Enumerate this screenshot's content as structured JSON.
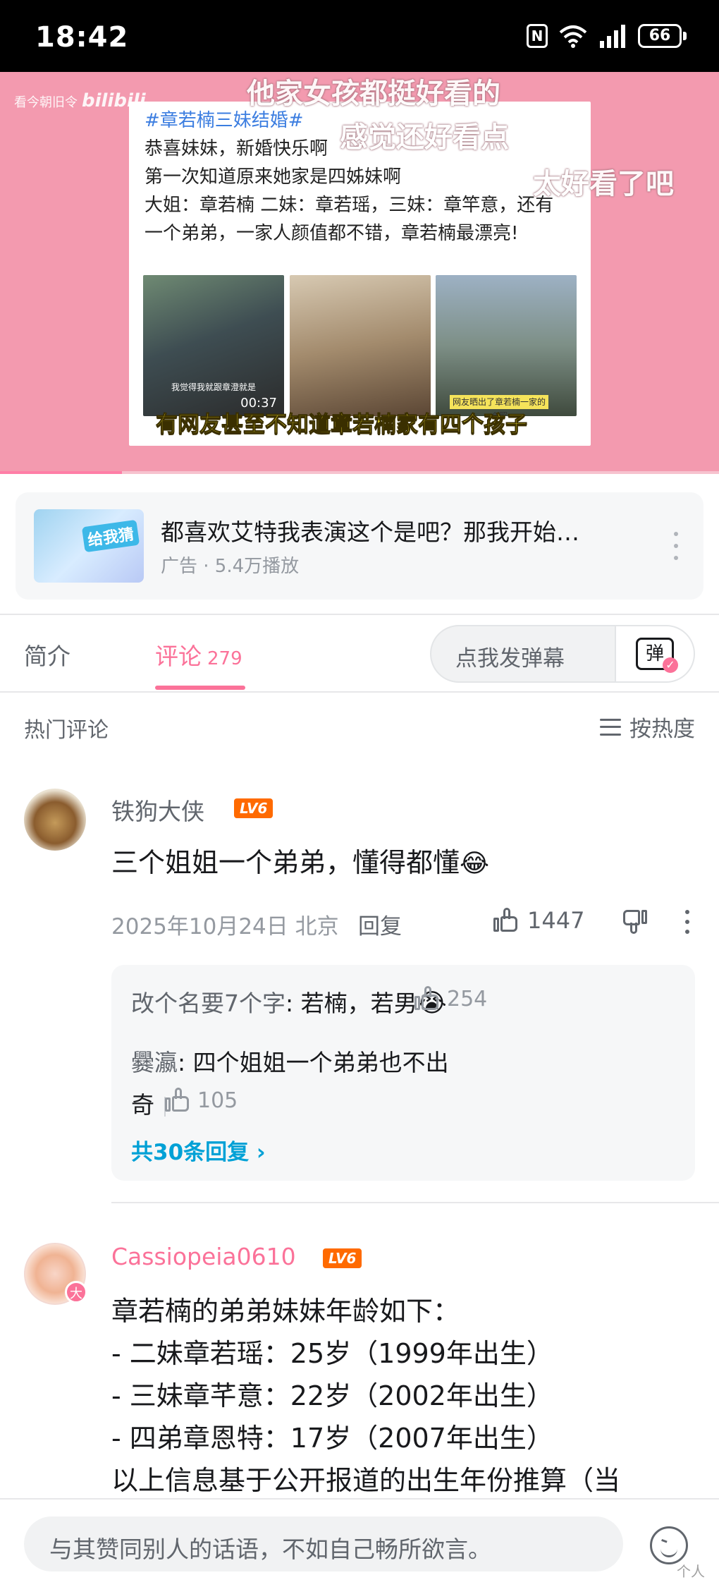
{
  "status_bar": {
    "time": "18:42",
    "nfc": "N",
    "battery": "66"
  },
  "video": {
    "watermark": "看今朝旧令",
    "logo": "bilibili",
    "card": {
      "tag": "#章若楠三妹结婚#",
      "lines": [
        "恭喜妹妹，新婚快乐啊",
        "第一次知道原来她家是四姊妹啊",
        "大姐：章若楠 二妹：章若瑶，三妹：章竿意，还有",
        "一个弟弟，一家人颜值都不错，章若楠最漂亮!"
      ],
      "thumb1_caption": "我觉得我就跟章澄就是",
      "thumb1_duration": "00:37",
      "thumb3_caption": "网友晒出了章若楠一家的合照",
      "yellow_caption": "有网友甚至不知道章若楠家有四个孩子"
    },
    "danmaku": [
      "他家女孩都挺好看的",
      "感觉还好看点",
      "太好看了吧"
    ],
    "progress_fraction": 0.17
  },
  "ad": {
    "title": "都喜欢艾特我表演这个是吧？那我开始…",
    "meta": "广告 · 5.4万播放",
    "thumb_text": "给我猜"
  },
  "tabs": {
    "intro": "简介",
    "comments": "评论",
    "comments_count": "279",
    "danmu_placeholder": "点我发弹幕",
    "danmu_button": "弹"
  },
  "comments_header": {
    "hot": "热门评论",
    "sort": "按热度"
  },
  "comments": [
    {
      "user": "铁狗大侠",
      "level": "LV6",
      "text": "三个姐姐一个弟弟，懂得都懂",
      "emoji": "😂",
      "date_location": "2025年10月24日 北京",
      "reply": "回复",
      "likes": "1447",
      "replies": [
        {
          "user": "改个名要7个字",
          "text": ": 若楠，若男",
          "emoji": "😭",
          "likes": "254"
        },
        {
          "user": "爨瀛",
          "text": ": 四个姐姐一个弟弟也不出",
          "text2": "奇",
          "likes": "105"
        }
      ],
      "reply_total": "共30条回复 ›"
    },
    {
      "user": "Cassiopeia0610",
      "level": "LV6",
      "badge": "大",
      "lines": [
        "章若楠的弟弟妹妹年龄如下：",
        "- 二妹章若瑶：25岁（1999年出生）",
        "- 三妹章芊意：22岁（2002年出生）",
        "- 四弟章恩特：17岁（2007年出生）",
        "以上信息基于公开报道的出生年份推算（当"
      ]
    }
  ],
  "bottom_bar": {
    "placeholder": "与其赞同别人的话语，不如自己畅所欲言。"
  },
  "weibo_watermark": "个人"
}
